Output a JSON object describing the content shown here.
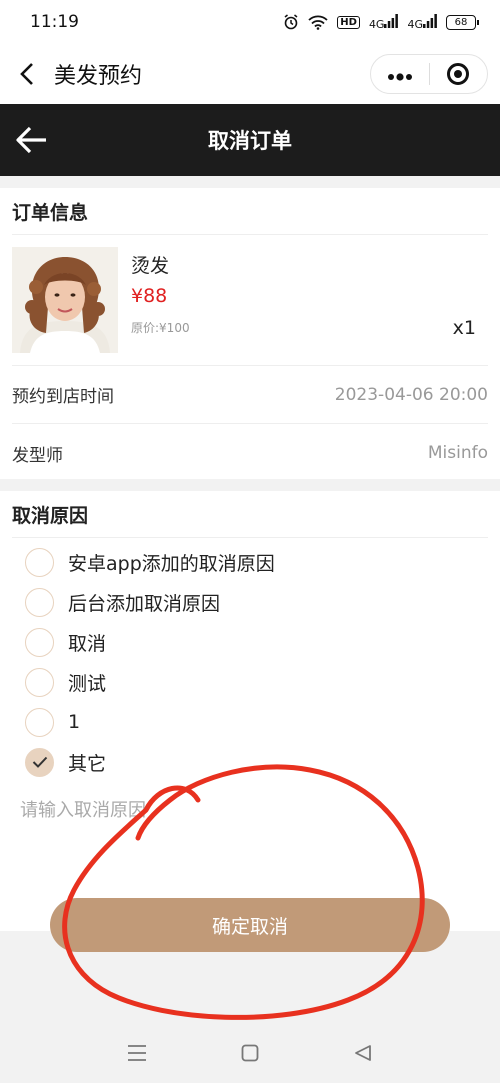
{
  "status_bar": {
    "time": "11:19",
    "network_a": "4G",
    "network_b": "4G",
    "hd": "HD",
    "battery": "68"
  },
  "navbar": {
    "title": "美发预约"
  },
  "header": {
    "title": "取消订单"
  },
  "order": {
    "section_title": "订单信息",
    "product": {
      "name": "烫发",
      "price": "¥88",
      "original_price": "原价:¥100",
      "quantity": "x1"
    },
    "rows": [
      {
        "label": "预约到店时间",
        "value": "2023-04-06 20:00"
      },
      {
        "label": "发型师",
        "value": "Misinfo"
      }
    ]
  },
  "cancel": {
    "section_title": "取消原因",
    "reasons": [
      {
        "label": "安卓app添加的取消原因",
        "checked": false
      },
      {
        "label": "后台添加取消原因",
        "checked": false
      },
      {
        "label": "取消",
        "checked": false
      },
      {
        "label": "测试",
        "checked": false
      },
      {
        "label": "1",
        "checked": false
      },
      {
        "label": "其它",
        "checked": true
      }
    ],
    "remark_placeholder": "请输入取消原因",
    "remark_value": ""
  },
  "confirm_button": {
    "label": "确定取消"
  },
  "colors": {
    "accent": "#c19a78",
    "radio_border": "#e8d3bf",
    "price": "#e02020",
    "header_bg": "#1c1c1c",
    "annotation": "#e8311f"
  }
}
